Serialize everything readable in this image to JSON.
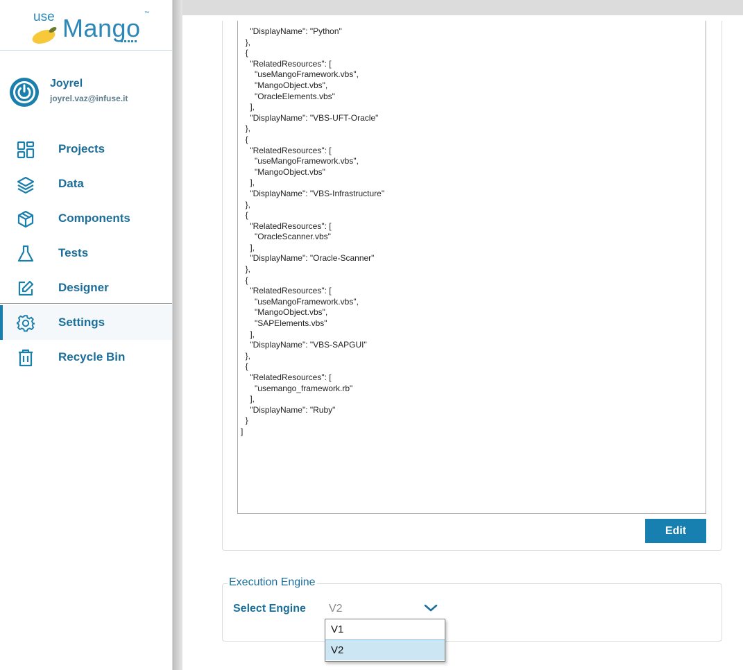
{
  "app": {
    "logo_prefix": "use",
    "logo_name": "Mango"
  },
  "user": {
    "name": "Joyrel",
    "email": "joyrel.vaz@infuse.it"
  },
  "nav": {
    "items": [
      {
        "label": "Projects",
        "icon": "projects-icon"
      },
      {
        "label": "Data",
        "icon": "layers-icon"
      },
      {
        "label": "Components",
        "icon": "cube-icon"
      },
      {
        "label": "Tests",
        "icon": "flask-icon"
      },
      {
        "label": "Designer",
        "icon": "edit-icon"
      },
      {
        "label": "Settings",
        "icon": "gear-icon",
        "active": true
      },
      {
        "label": "Recycle Bin",
        "icon": "trash-icon"
      }
    ]
  },
  "editor": {
    "content": "    \"DisplayName\": \"Python\"\n  },\n  {\n    \"RelatedResources\": [\n      \"useMangoFramework.vbs\",\n      \"MangoObject.vbs\",\n      \"OracleElements.vbs\"\n    ],\n    \"DisplayName\": \"VBS-UFT-Oracle\"\n  },\n  {\n    \"RelatedResources\": [\n      \"useMangoFramework.vbs\",\n      \"MangoObject.vbs\"\n    ],\n    \"DisplayName\": \"VBS-Infrastructure\"\n  },\n  {\n    \"RelatedResources\": [\n      \"OracleScanner.vbs\"\n    ],\n    \"DisplayName\": \"Oracle-Scanner\"\n  },\n  {\n    \"RelatedResources\": [\n      \"useMangoFramework.vbs\",\n      \"MangoObject.vbs\",\n      \"SAPElements.vbs\"\n    ],\n    \"DisplayName\": \"VBS-SAPGUI\"\n  },\n  {\n    \"RelatedResources\": [\n      \"usemango_framework.rb\"\n    ],\n    \"DisplayName\": \"Ruby\"\n  }\n]",
    "edit_label": "Edit"
  },
  "execution": {
    "section_title": "Execution Engine",
    "select_label": "Select Engine",
    "selected": "V2",
    "options": [
      "V1",
      "V2"
    ]
  },
  "colors": {
    "accent": "#1780b0",
    "nav_text": "#1b6e9a",
    "dropdown_selected": "#cce6f4"
  }
}
